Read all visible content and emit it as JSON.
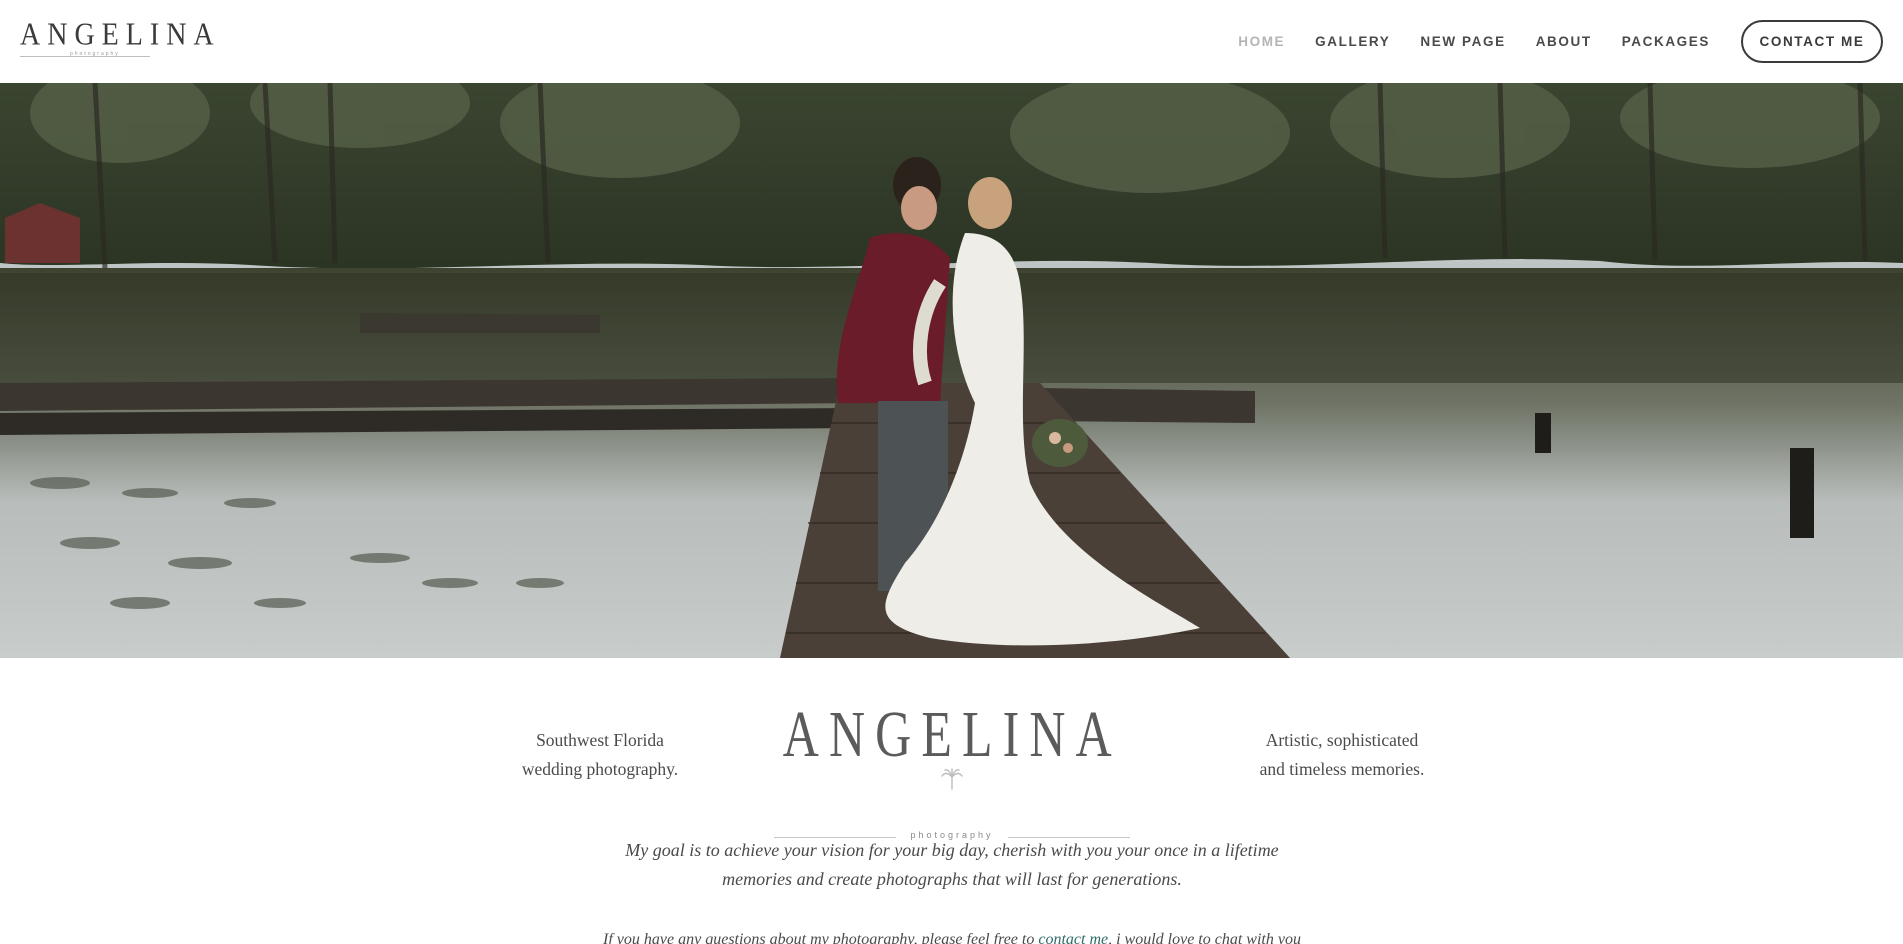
{
  "header": {
    "logo_text": "ANGELINA",
    "logo_sub": "photography",
    "nav": [
      {
        "label": "HOME",
        "active": true
      },
      {
        "label": "GALLERY",
        "active": false
      },
      {
        "label": "NEW PAGE",
        "active": false
      },
      {
        "label": "ABOUT",
        "active": false
      },
      {
        "label": "PACKAGES",
        "active": false
      }
    ],
    "contact_button": "CONTACT ME"
  },
  "hero": {
    "image_alt": "Bride and groom on a wooden dock over a lake"
  },
  "intro": {
    "tagline_left_1": "Southwest Florida",
    "tagline_left_2": "wedding photography.",
    "tagline_right_1": "Artistic, sophisticated",
    "tagline_right_2": "and timeless memories.",
    "logo_text": "ANGELINA",
    "logo_sub": "photography",
    "mission_1": "My goal is to achieve your vision for your big day, cherish with you your once in a lifetime",
    "mission_2": "memories and create photographs that will last for generations.",
    "contact_prefix": "If you have any questions about my photography, please feel free to ",
    "contact_link": "contact me",
    "contact_suffix": ", i would love to chat with you"
  },
  "colors": {
    "nav_text": "#4a4a4a",
    "nav_active": "#b5b5b5",
    "link": "#2f6b6a",
    "background": "#ffffff"
  }
}
